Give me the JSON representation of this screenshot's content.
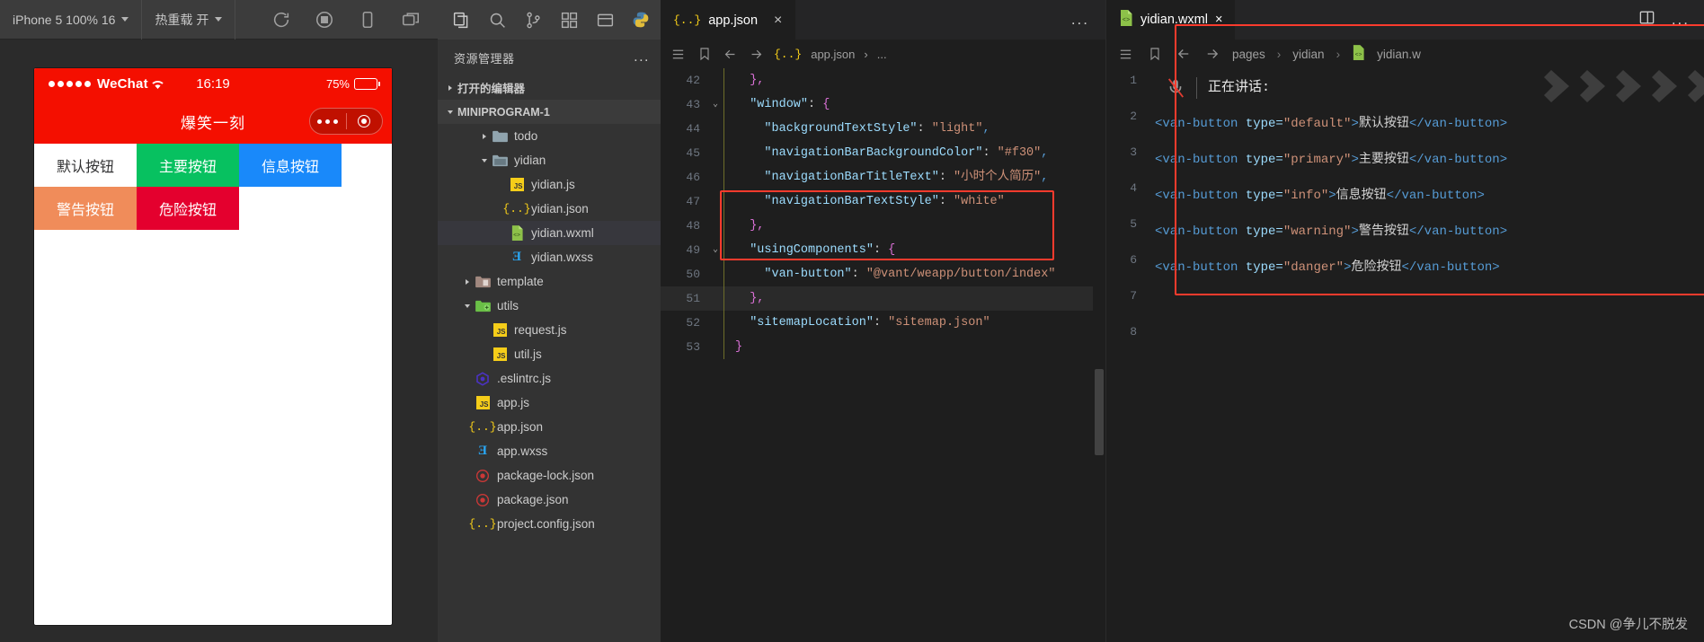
{
  "simulator": {
    "device_label": "iPhone 5 100% 16",
    "hot_reload_label": "热重载 开",
    "toolbar_icons": [
      "refresh-icon",
      "record-icon",
      "mobile-icon",
      "window-icon"
    ],
    "phone": {
      "carrier": "WeChat",
      "time": "16:19",
      "battery": "75%",
      "nav_title": "爆笑一刻",
      "buttons": [
        {
          "label": "默认按钮",
          "type": "default"
        },
        {
          "label": "主要按钮",
          "type": "primary"
        },
        {
          "label": "信息按钮",
          "type": "info"
        },
        {
          "label": "警告按钮",
          "type": "warning"
        },
        {
          "label": "危险按钮",
          "type": "danger"
        }
      ]
    }
  },
  "activity_bar": {
    "icons": [
      "files-icon",
      "search-icon",
      "source-control-icon",
      "extensions-icon",
      "layout-icon",
      "python-icon"
    ]
  },
  "explorer": {
    "title": "资源管理器",
    "more": "...",
    "open_editors_label": "打开的编辑器",
    "project_label": "MINIPROGRAM-1",
    "tree": [
      {
        "name": "todo",
        "icon": "folder-icon",
        "indent": 2,
        "twisty": "r",
        "selected": false
      },
      {
        "name": "yidian",
        "icon": "folder-open-icon",
        "indent": 2,
        "twisty": "d",
        "selected": false
      },
      {
        "name": "yidian.js",
        "icon": "js-icon",
        "indent": 3,
        "twisty": "none",
        "selected": false
      },
      {
        "name": "yidian.json",
        "icon": "json-icon",
        "indent": 3,
        "twisty": "none",
        "selected": false
      },
      {
        "name": "yidian.wxml",
        "icon": "wxml-icon",
        "indent": 3,
        "twisty": "none",
        "selected": true
      },
      {
        "name": "yidian.wxss",
        "icon": "wxss-icon",
        "indent": 3,
        "twisty": "none",
        "selected": false
      },
      {
        "name": "template",
        "icon": "folder-tpl-icon",
        "indent": 1,
        "twisty": "r",
        "selected": false
      },
      {
        "name": "utils",
        "icon": "folder-utils-icon",
        "indent": 1,
        "twisty": "d",
        "selected": false
      },
      {
        "name": "request.js",
        "icon": "js-icon",
        "indent": 2,
        "twisty": "none",
        "selected": false
      },
      {
        "name": "util.js",
        "icon": "js-icon",
        "indent": 2,
        "twisty": "none",
        "selected": false
      },
      {
        "name": ".eslintrc.js",
        "icon": "eslint-icon",
        "indent": 1,
        "twisty": "none",
        "selected": false
      },
      {
        "name": "app.js",
        "icon": "js-icon",
        "indent": 1,
        "twisty": "none",
        "selected": false
      },
      {
        "name": "app.json",
        "icon": "json-icon",
        "indent": 1,
        "twisty": "none",
        "selected": false
      },
      {
        "name": "app.wxss",
        "icon": "wxss-icon",
        "indent": 1,
        "twisty": "none",
        "selected": false
      },
      {
        "name": "package-lock.json",
        "icon": "npm-icon",
        "indent": 1,
        "twisty": "none",
        "selected": false
      },
      {
        "name": "package.json",
        "icon": "npm-icon",
        "indent": 1,
        "twisty": "none",
        "selected": false
      },
      {
        "name": "project.config.json",
        "icon": "json-icon",
        "indent": 1,
        "twisty": "none",
        "selected": false
      }
    ]
  },
  "center_editor": {
    "tab_label": "app.json",
    "tab_icon": "json-icon",
    "tab_close": "×",
    "more": "...",
    "breadcrumb_file": "app.json",
    "breadcrumb_tail": "...",
    "breadcrumb_icons": [
      "outline-icon",
      "bookmark-icon"
    ],
    "lines": [
      {
        "num": "42",
        "fold": "",
        "hl": false,
        "tokens": [
          {
            "t": "  },",
            "c": "k-brace"
          }
        ]
      },
      {
        "num": "43",
        "fold": "v",
        "hl": false,
        "tokens": [
          {
            "t": "  ",
            "c": "k-punc"
          },
          {
            "t": "\"window\"",
            "c": "k-key"
          },
          {
            "t": ": ",
            "c": "k-punc"
          },
          {
            "t": "{",
            "c": "k-brace"
          }
        ]
      },
      {
        "num": "44",
        "fold": "",
        "hl": false,
        "tokens": [
          {
            "t": "    ",
            "c": "k-punc"
          },
          {
            "t": "\"backgroundTextStyle\"",
            "c": "k-key"
          },
          {
            "t": ": ",
            "c": "k-punc"
          },
          {
            "t": "\"light\"",
            "c": "k-str"
          },
          {
            "t": ",",
            "c": "k-comma"
          }
        ]
      },
      {
        "num": "45",
        "fold": "",
        "hl": false,
        "tokens": [
          {
            "t": "    ",
            "c": "k-punc"
          },
          {
            "t": "\"navigationBarBackgroundColor\"",
            "c": "k-key"
          },
          {
            "t": ": ",
            "c": "k-punc"
          },
          {
            "t": "\"#f30\"",
            "c": "k-str"
          },
          {
            "t": ",",
            "c": "k-comma"
          }
        ]
      },
      {
        "num": "46",
        "fold": "",
        "hl": false,
        "tokens": [
          {
            "t": "    ",
            "c": "k-punc"
          },
          {
            "t": "\"navigationBarTitleText\"",
            "c": "k-key"
          },
          {
            "t": ": ",
            "c": "k-punc"
          },
          {
            "t": "\"小时个人简历\"",
            "c": "k-str"
          },
          {
            "t": ",",
            "c": "k-comma"
          }
        ]
      },
      {
        "num": "47",
        "fold": "",
        "hl": false,
        "tokens": [
          {
            "t": "    ",
            "c": "k-punc"
          },
          {
            "t": "\"navigationBarTextStyle\"",
            "c": "k-key"
          },
          {
            "t": ": ",
            "c": "k-punc"
          },
          {
            "t": "\"white\"",
            "c": "k-str"
          }
        ]
      },
      {
        "num": "48",
        "fold": "",
        "hl": false,
        "tokens": [
          {
            "t": "  },",
            "c": "k-brace"
          }
        ]
      },
      {
        "num": "49",
        "fold": "v",
        "hl": false,
        "tokens": [
          {
            "t": "  ",
            "c": "k-punc"
          },
          {
            "t": "\"usingComponents\"",
            "c": "k-key"
          },
          {
            "t": ": ",
            "c": "k-punc"
          },
          {
            "t": "{",
            "c": "k-brace"
          }
        ]
      },
      {
        "num": "50",
        "fold": "",
        "hl": false,
        "tokens": [
          {
            "t": "    ",
            "c": "k-punc"
          },
          {
            "t": "\"van-button\"",
            "c": "k-key"
          },
          {
            "t": ": ",
            "c": "k-punc"
          },
          {
            "t": "\"@vant/weapp/button/index\"",
            "c": "k-str"
          }
        ]
      },
      {
        "num": "51",
        "fold": "",
        "hl": true,
        "tokens": [
          {
            "t": "  },",
            "c": "k-brace"
          }
        ]
      },
      {
        "num": "52",
        "fold": "",
        "hl": false,
        "tokens": [
          {
            "t": "  ",
            "c": "k-punc"
          },
          {
            "t": "\"sitemapLocation\"",
            "c": "k-key"
          },
          {
            "t": ": ",
            "c": "k-punc"
          },
          {
            "t": "\"sitemap.json\"",
            "c": "k-str"
          }
        ]
      },
      {
        "num": "53",
        "fold": "",
        "hl": false,
        "tokens": [
          {
            "t": "}",
            "c": "k-brace"
          }
        ]
      }
    ]
  },
  "right_editor": {
    "tab_label": "yidian.wxml",
    "tab_icon": "wxml-icon",
    "tab_close": "×",
    "split_icon": "split-editor-icon",
    "more": "...",
    "breadcrumb": [
      "pages",
      "yidian",
      "yidian.w"
    ],
    "breadcrumb_icons": [
      "outline-icon",
      "bookmark-icon",
      "back-arrow-icon",
      "forward-arrow-icon"
    ],
    "speaking_label": "正在讲话:",
    "mic_icon": "mic-muted-icon",
    "lines": [
      {
        "num": "1",
        "kind": "speaking"
      },
      {
        "num": "2",
        "kind": "code",
        "parts": [
          {
            "t": "<van-button",
            "c": "tag-name"
          },
          {
            "t": " type=",
            "c": "tag-attr"
          },
          {
            "t": "\"default\"",
            "c": "tag-val"
          },
          {
            "t": ">",
            "c": "tag-name"
          },
          {
            "t": "默认按钮",
            "c": "tag-txt"
          },
          {
            "t": "</van-button>",
            "c": "tag-name"
          }
        ]
      },
      {
        "num": "3",
        "kind": "code",
        "parts": [
          {
            "t": "<van-button",
            "c": "tag-name"
          },
          {
            "t": " type=",
            "c": "tag-attr"
          },
          {
            "t": "\"primary\"",
            "c": "tag-val"
          },
          {
            "t": ">",
            "c": "tag-name"
          },
          {
            "t": "主要按钮",
            "c": "tag-txt"
          },
          {
            "t": "</van-button>",
            "c": "tag-name"
          }
        ]
      },
      {
        "num": "4",
        "kind": "code",
        "parts": [
          {
            "t": "<van-button",
            "c": "tag-name"
          },
          {
            "t": " type=",
            "c": "tag-attr"
          },
          {
            "t": "\"info\"",
            "c": "tag-val"
          },
          {
            "t": ">",
            "c": "tag-name"
          },
          {
            "t": "信息按钮",
            "c": "tag-txt"
          },
          {
            "t": "</van-button>",
            "c": "tag-name"
          }
        ]
      },
      {
        "num": "5",
        "kind": "code",
        "parts": [
          {
            "t": "<van-button",
            "c": "tag-name"
          },
          {
            "t": " type=",
            "c": "tag-attr"
          },
          {
            "t": "\"warning\"",
            "c": "tag-val"
          },
          {
            "t": ">",
            "c": "tag-name"
          },
          {
            "t": "警告按钮",
            "c": "tag-txt"
          },
          {
            "t": "</van-button>",
            "c": "tag-name"
          }
        ]
      },
      {
        "num": "6",
        "kind": "code",
        "parts": [
          {
            "t": "<van-button",
            "c": "tag-name"
          },
          {
            "t": " type=",
            "c": "tag-attr"
          },
          {
            "t": "\"danger\"",
            "c": "tag-val"
          },
          {
            "t": ">",
            "c": "tag-name"
          },
          {
            "t": "危险按钮",
            "c": "tag-txt"
          },
          {
            "t": "</van-button>",
            "c": "tag-name"
          }
        ]
      },
      {
        "num": "7",
        "kind": "code",
        "parts": []
      },
      {
        "num": "8",
        "kind": "code",
        "parts": []
      }
    ]
  },
  "watermark": "CSDN @争儿不脱发",
  "colors": {
    "wechat_red": "#f40f00",
    "primary_green": "#07c160",
    "info_blue": "#1989fa",
    "warning_orange": "#f08c5a",
    "danger_red": "#e4002e",
    "highlight_box": "#fc3b2d"
  }
}
